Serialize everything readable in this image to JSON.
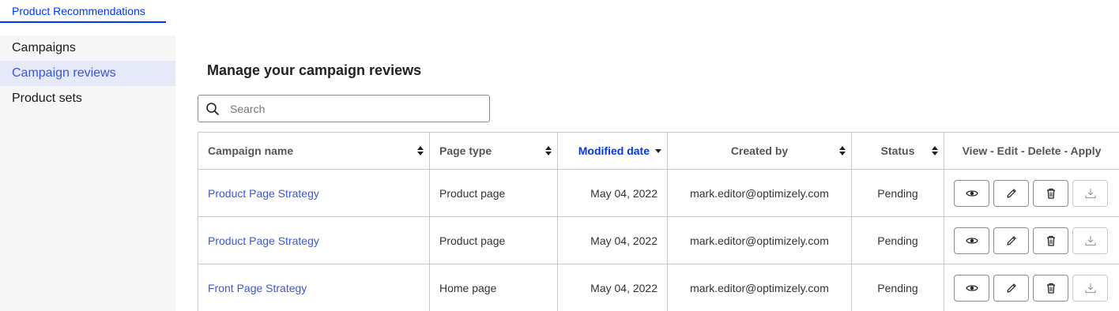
{
  "app": {
    "tab_label": "Product Recommendations"
  },
  "sidebar": {
    "items": [
      {
        "label": "Campaigns",
        "active": false
      },
      {
        "label": "Campaign reviews",
        "active": true
      },
      {
        "label": "Product sets",
        "active": false
      }
    ]
  },
  "main": {
    "title": "Manage your campaign reviews",
    "search": {
      "placeholder": "Search",
      "value": ""
    },
    "table": {
      "headers": {
        "campaign_name": "Campaign name",
        "page_type": "Page type",
        "modified_date": "Modified date",
        "created_by": "Created by",
        "status": "Status",
        "actions": "View - Edit - Delete - Apply"
      },
      "sorted_column": "modified_date",
      "rows": [
        {
          "campaign_name": "Product Page Strategy",
          "page_type": "Product page",
          "modified_date": "May 04, 2022",
          "created_by": "mark.editor@optimizely.com",
          "status": "Pending"
        },
        {
          "campaign_name": "Product Page Strategy",
          "page_type": "Product page",
          "modified_date": "May 04, 2022",
          "created_by": "mark.editor@optimizely.com",
          "status": "Pending"
        },
        {
          "campaign_name": "Front Page Strategy",
          "page_type": "Home page",
          "modified_date": "May 04, 2022",
          "created_by": "mark.editor@optimizely.com",
          "status": "Pending"
        }
      ],
      "row_actions": [
        "eye-icon",
        "pencil-icon",
        "trash-icon",
        "download-icon"
      ]
    }
  },
  "colors": {
    "accent": "#0037ff",
    "link": "#3b56e0",
    "active_nav_bg": "#e6e9f7",
    "sidebar_bg": "#f6f6f6"
  }
}
